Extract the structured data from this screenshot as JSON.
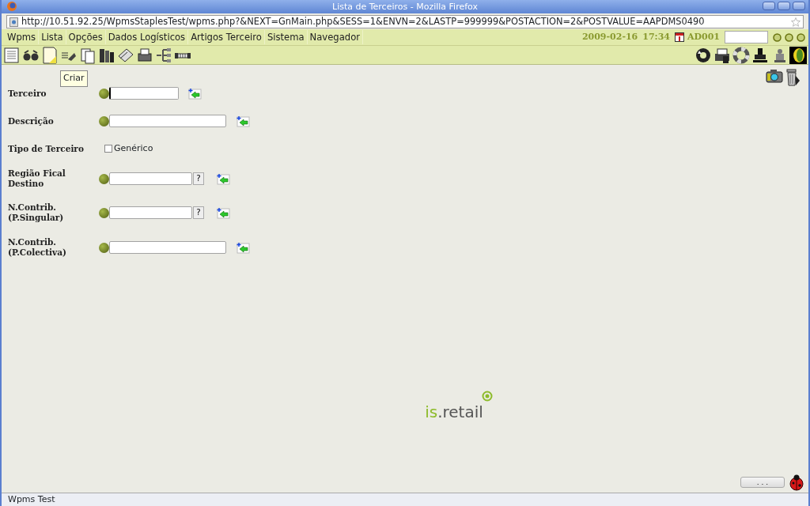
{
  "window": {
    "title": "Lista de Terceiros - Mozilla Firefox"
  },
  "address_bar": {
    "url": "http://10.51.92.25/WpmsStaplesTest/wpms.php?&NEXT=GnMain.php&SESS=1&ENVN=2&LASTP=999999&POSTACTION=2&POSTVALUE=AAPDMS0490"
  },
  "menu": [
    "Wpms",
    "Lista",
    "Opções",
    "Dados Logísticos",
    "Artigos Terceiro",
    "Sistema",
    "Navegador"
  ],
  "header_info": {
    "date": "2009-02-16",
    "time": "17:34",
    "user": "AD001"
  },
  "tooltip": "Criar",
  "form": [
    {
      "label": "Terceiro",
      "kind": "text",
      "wide": false,
      "focused": true
    },
    {
      "label": "Descrição",
      "kind": "text",
      "wide": true,
      "focused": false
    },
    {
      "label": "Tipo de Terceiro",
      "kind": "checkbox",
      "option": "Genérico",
      "checked": false
    },
    {
      "label": "Região Fical Destino",
      "kind": "lookup",
      "help": "?",
      "focused": false
    },
    {
      "label": "N.Contrib. (P.Singular)",
      "kind": "lookup",
      "help": "?",
      "focused": false
    },
    {
      "label": "N.Contrib. (P.Colectiva)",
      "kind": "text",
      "wide": true,
      "focused": false
    }
  ],
  "logo": {
    "prefix": "is",
    "suffix": ".retail"
  },
  "footer_button": ". . .",
  "status_bar": "Wpms Test"
}
